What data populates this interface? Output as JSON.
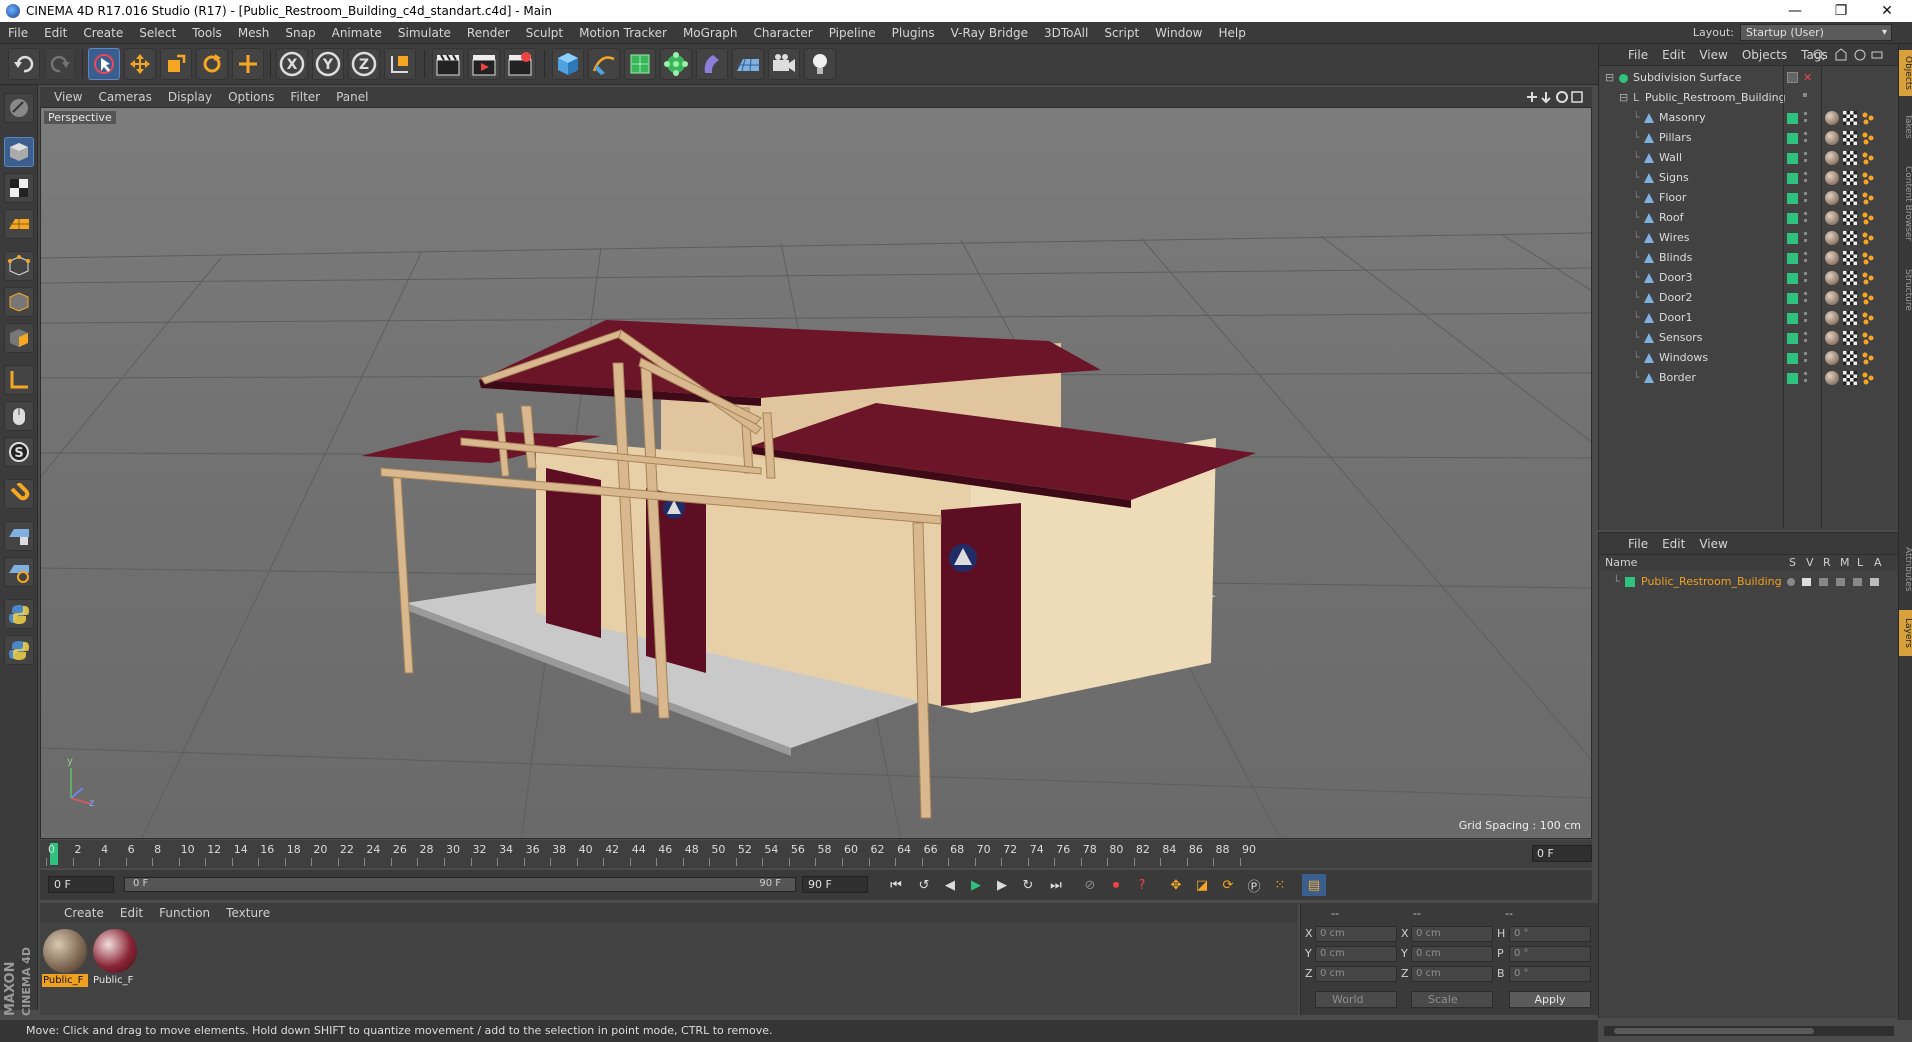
{
  "window": {
    "title": "CINEMA 4D R17.016 Studio (R17) - [Public_Restroom_Building_c4d_standart.c4d] - Main",
    "minimize": "—",
    "restore": "❐",
    "close": "✕"
  },
  "menubar": {
    "items": [
      "File",
      "Edit",
      "Create",
      "Select",
      "Tools",
      "Mesh",
      "Snap",
      "Animate",
      "Simulate",
      "Render",
      "Sculpt",
      "Motion Tracker",
      "MoGraph",
      "Character",
      "Pipeline",
      "Plugins",
      "V-Ray Bridge",
      "3DToAll",
      "Script",
      "Window",
      "Help"
    ],
    "layout_label": "Layout:",
    "layout_value": "Startup (User)"
  },
  "viewport": {
    "menu": [
      "View",
      "Cameras",
      "Display",
      "Options",
      "Filter",
      "Panel"
    ],
    "label": "Perspective",
    "grid_spacing": "Grid Spacing : 100 cm",
    "axis_y": "y",
    "axis_z": "z"
  },
  "timeline": {
    "ticks": [
      "0",
      "2",
      "4",
      "6",
      "8",
      "10",
      "12",
      "14",
      "16",
      "18",
      "20",
      "22",
      "24",
      "26",
      "28",
      "30",
      "32",
      "34",
      "36",
      "38",
      "40",
      "42",
      "44",
      "46",
      "48",
      "50",
      "52",
      "54",
      "56",
      "58",
      "60",
      "62",
      "64",
      "66",
      "68",
      "70",
      "72",
      "74",
      "76",
      "78",
      "80",
      "82",
      "84",
      "86",
      "88",
      "90"
    ],
    "current_frame": "0 F"
  },
  "transport": {
    "start": "0 F",
    "range_start": "0 F",
    "range_end": "90 F",
    "end": "90 F"
  },
  "materials": {
    "menu": [
      "Create",
      "Edit",
      "Function",
      "Texture"
    ],
    "items": [
      {
        "label": "Public_F",
        "selected": true
      },
      {
        "label": "Public_F",
        "selected": false
      }
    ]
  },
  "coordinates": {
    "header": [
      "--",
      "--",
      "--"
    ],
    "rows": [
      {
        "a": "X",
        "av": "0 cm",
        "b": "X",
        "bv": "0 cm",
        "c": "H",
        "cv": "0 °"
      },
      {
        "a": "Y",
        "av": "0 cm",
        "b": "Y",
        "bv": "0 cm",
        "c": "P",
        "cv": "0 °"
      },
      {
        "a": "Z",
        "av": "0 cm",
        "b": "Z",
        "bv": "0 cm",
        "c": "B",
        "cv": "0 °"
      }
    ],
    "space": "World",
    "mode": "Scale",
    "apply": "Apply"
  },
  "status": "Move: Click and drag to move elements. Hold down SHIFT to quantize movement / add to the selection in point mode, CTRL to remove.",
  "brand": {
    "line1": "MAXON",
    "line2": "CINEMA 4D"
  },
  "objects": {
    "menu": [
      "File",
      "Edit",
      "View",
      "Objects",
      "Tags"
    ],
    "root": "Subdivision Surface",
    "group": "Public_Restroom_Building",
    "children": [
      "Masonry",
      "Pillars",
      "Wall",
      "Signs",
      "Floor",
      "Roof",
      "Wires",
      "Blinds",
      "Door3",
      "Door2",
      "Door1",
      "Sensors",
      "Windows",
      "Border"
    ]
  },
  "layers": {
    "menu": [
      "File",
      "Edit",
      "View"
    ],
    "columns": {
      "name": "Name",
      "s": "S",
      "v": "V",
      "r": "R",
      "m": "M",
      "l": "L",
      "a": "A"
    },
    "row": "Public_Restroom_Building"
  },
  "sidetabs": [
    "Objects",
    "Takes",
    "Content Browser",
    "Structure",
    "Attributes",
    "Layers"
  ],
  "colors": {
    "accent": "#3a5f8f",
    "selection": "#f0a020",
    "layer_name": "#f0a020",
    "active_green": "#2ec27e"
  }
}
